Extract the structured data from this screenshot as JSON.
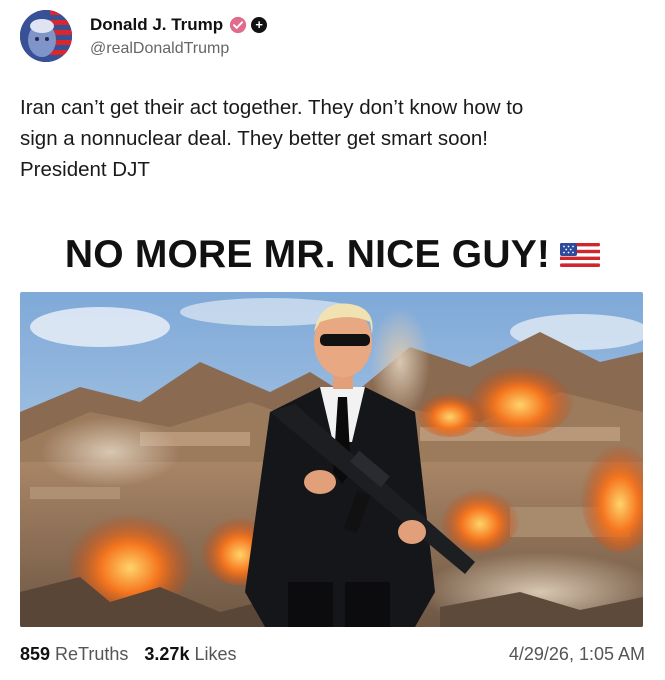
{
  "post": {
    "author_name": "Donald J. Trump",
    "handle": "@realDonaldTrump",
    "text": "Iran can’t get their act together. They don’t know how to\nsign a nonnuclear deal. They better get smart soon!\nPresident DJT",
    "image_headline": "NO MORE MR. NICE GUY!",
    "stats": {
      "retruths_count": "859",
      "retruths_label": "ReTruths",
      "likes_count": "3.27k",
      "likes_label": "Likes"
    },
    "timestamp": "4/29/26, 1:05 AM"
  },
  "icons": {
    "verified": "verified-badge-icon",
    "follow": "plus-icon",
    "flag": "us-flag-icon"
  },
  "colors": {
    "verified_badge": "#e06b8b",
    "sky": "#8fb6de",
    "desert": "#b08a66",
    "explosion": "#f06a1e"
  }
}
